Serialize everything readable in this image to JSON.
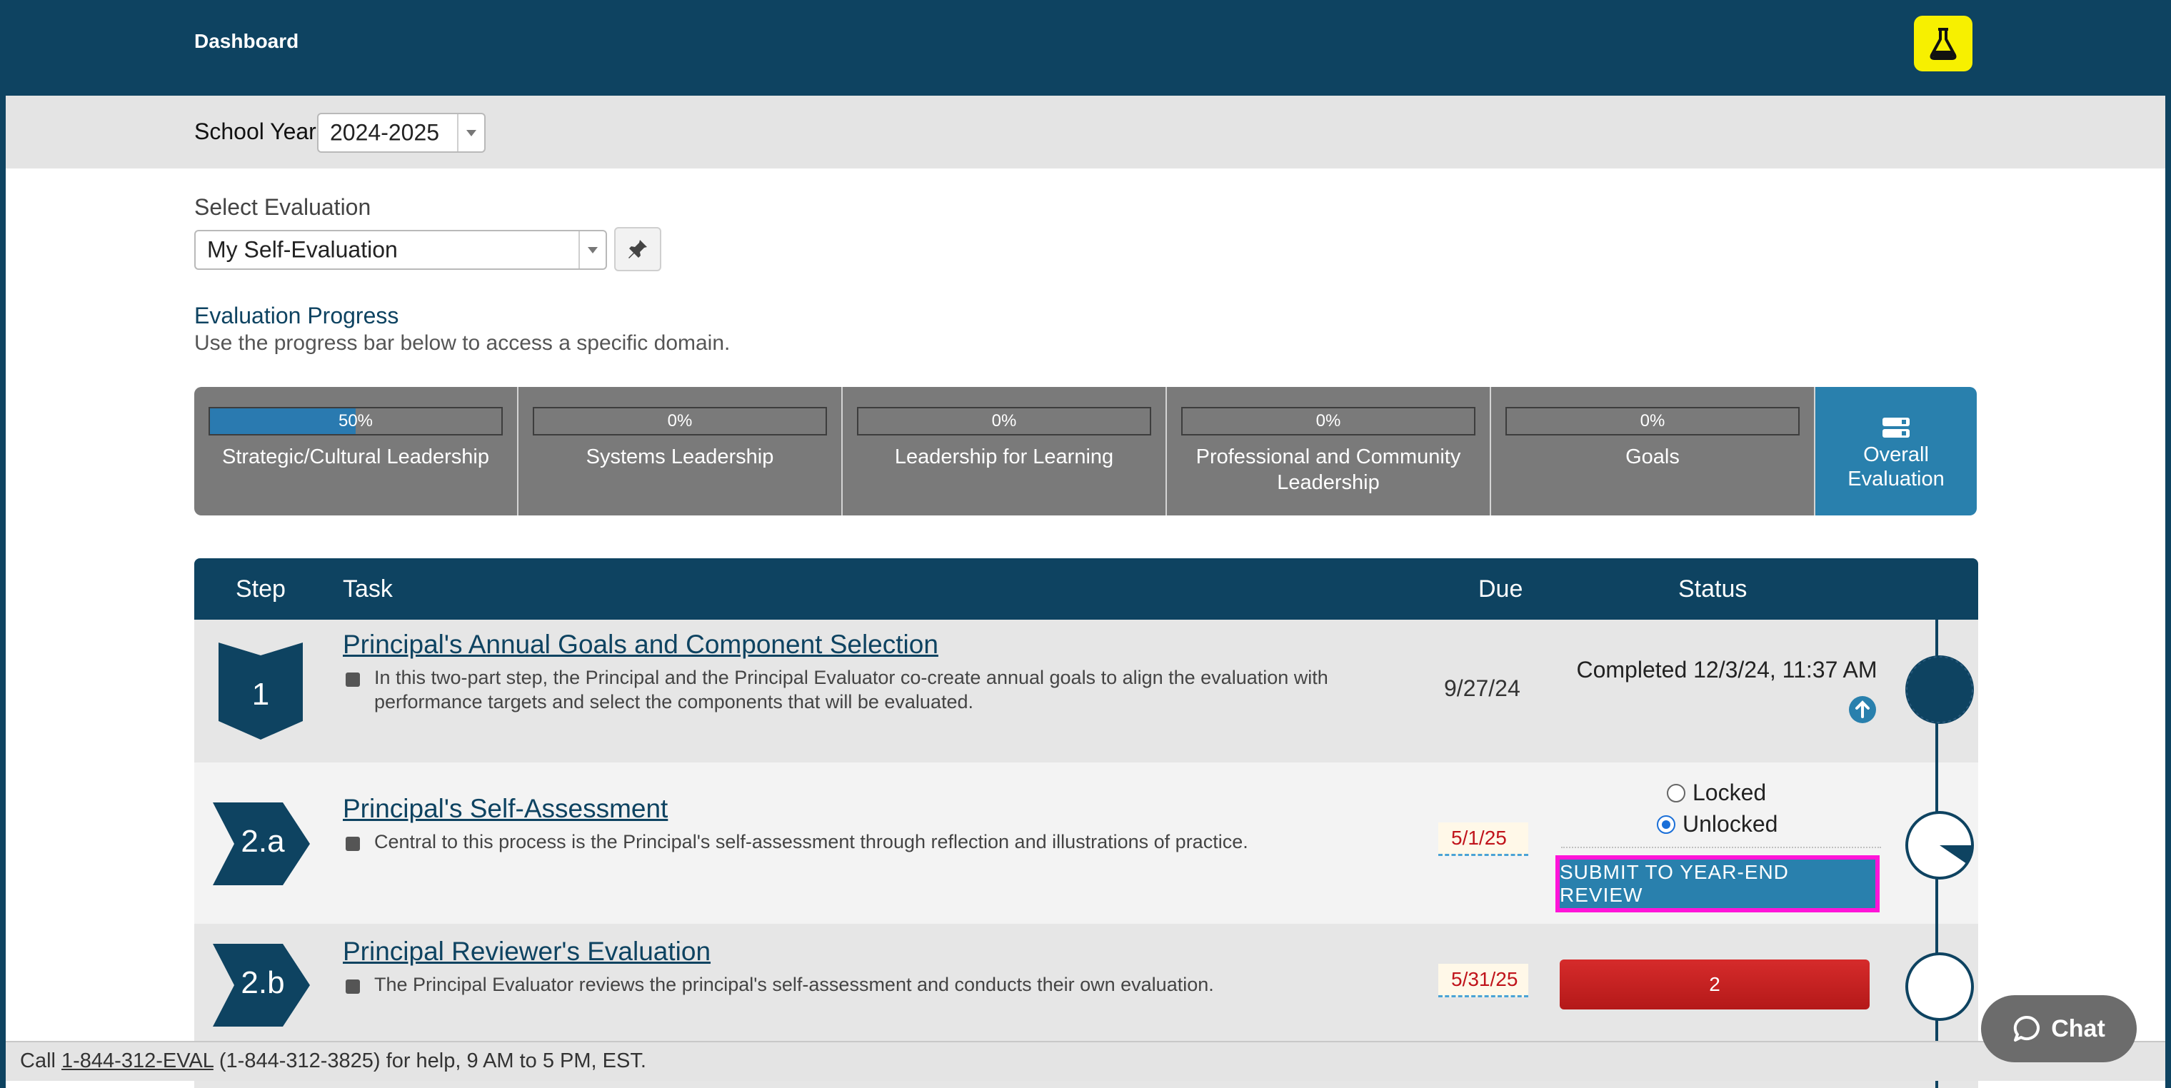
{
  "header": {
    "title": "Dashboard",
    "lab_icon": "flask-icon"
  },
  "school_year": {
    "label": "School Year:",
    "selected": "2024-2025"
  },
  "evaluation_select": {
    "label": "Select Evaluation",
    "selected": "My Self-Evaluation",
    "pin_icon": "pin-icon"
  },
  "progress": {
    "title": "Evaluation Progress",
    "subtitle": "Use the progress bar below to access a specific domain.",
    "domains": [
      {
        "name": "Strategic/Cultural Leadership",
        "percent_label": "50%",
        "percent": 50
      },
      {
        "name": "Systems Leadership",
        "percent_label": "0%",
        "percent": 0
      },
      {
        "name": "Leadership for Learning",
        "percent_label": "0%",
        "percent": 0
      },
      {
        "name": "Professional and Community Leadership",
        "percent_label": "0%",
        "percent": 0
      },
      {
        "name": "Goals",
        "percent_label": "0%",
        "percent": 0
      }
    ],
    "overall": {
      "name": "Overall Evaluation",
      "icon": "overall-evaluation-icon"
    }
  },
  "tasks": {
    "headers": {
      "step": "Step",
      "task": "Task",
      "due": "Due",
      "status": "Status"
    },
    "rows": [
      {
        "step": "1",
        "title": "Principal's Annual Goals and Component Selection",
        "description": "In this two-part step, the Principal and the Principal Evaluator co-create annual goals to align the evaluation with performance targets and select the components that will be evaluated.",
        "due": "9/27/24",
        "status": "Completed 12/3/24, 11:37 AM",
        "progress": 1.0
      },
      {
        "step": "2.a",
        "title": "Principal's Self-Assessment",
        "description": "Central to this process is the Principal's self-assessment through reflection and illustrations of practice.",
        "due": "5/1/25",
        "radio_locked": "Locked",
        "radio_unlocked": "Unlocked",
        "submit_label": "SUBMIT TO YEAR-END REVIEW",
        "progress": 0.1
      },
      {
        "step": "2.b",
        "title": "Principal Reviewer's Evaluation",
        "description": "The Principal Evaluator reviews the principal's self-assessment and conducts their own evaluation.",
        "due": "5/31/25",
        "status_button": "2",
        "progress": 0
      }
    ]
  },
  "footer": {
    "prefix": "Call ",
    "phone_link": "1-844-312-EVAL",
    "suffix": " (1-844-312-3825) for help, 9 AM to 5 PM, EST."
  },
  "chat": {
    "label": "Chat",
    "icon": "chat-bubble-icon"
  },
  "colors": {
    "navy": "#0e4361",
    "accent_blue": "#2980ad",
    "domain_gray": "#7a7a7a",
    "danger_red": "#c0141b",
    "highlight_magenta": "#ff14d8",
    "lab_yellow": "#f7f000"
  }
}
